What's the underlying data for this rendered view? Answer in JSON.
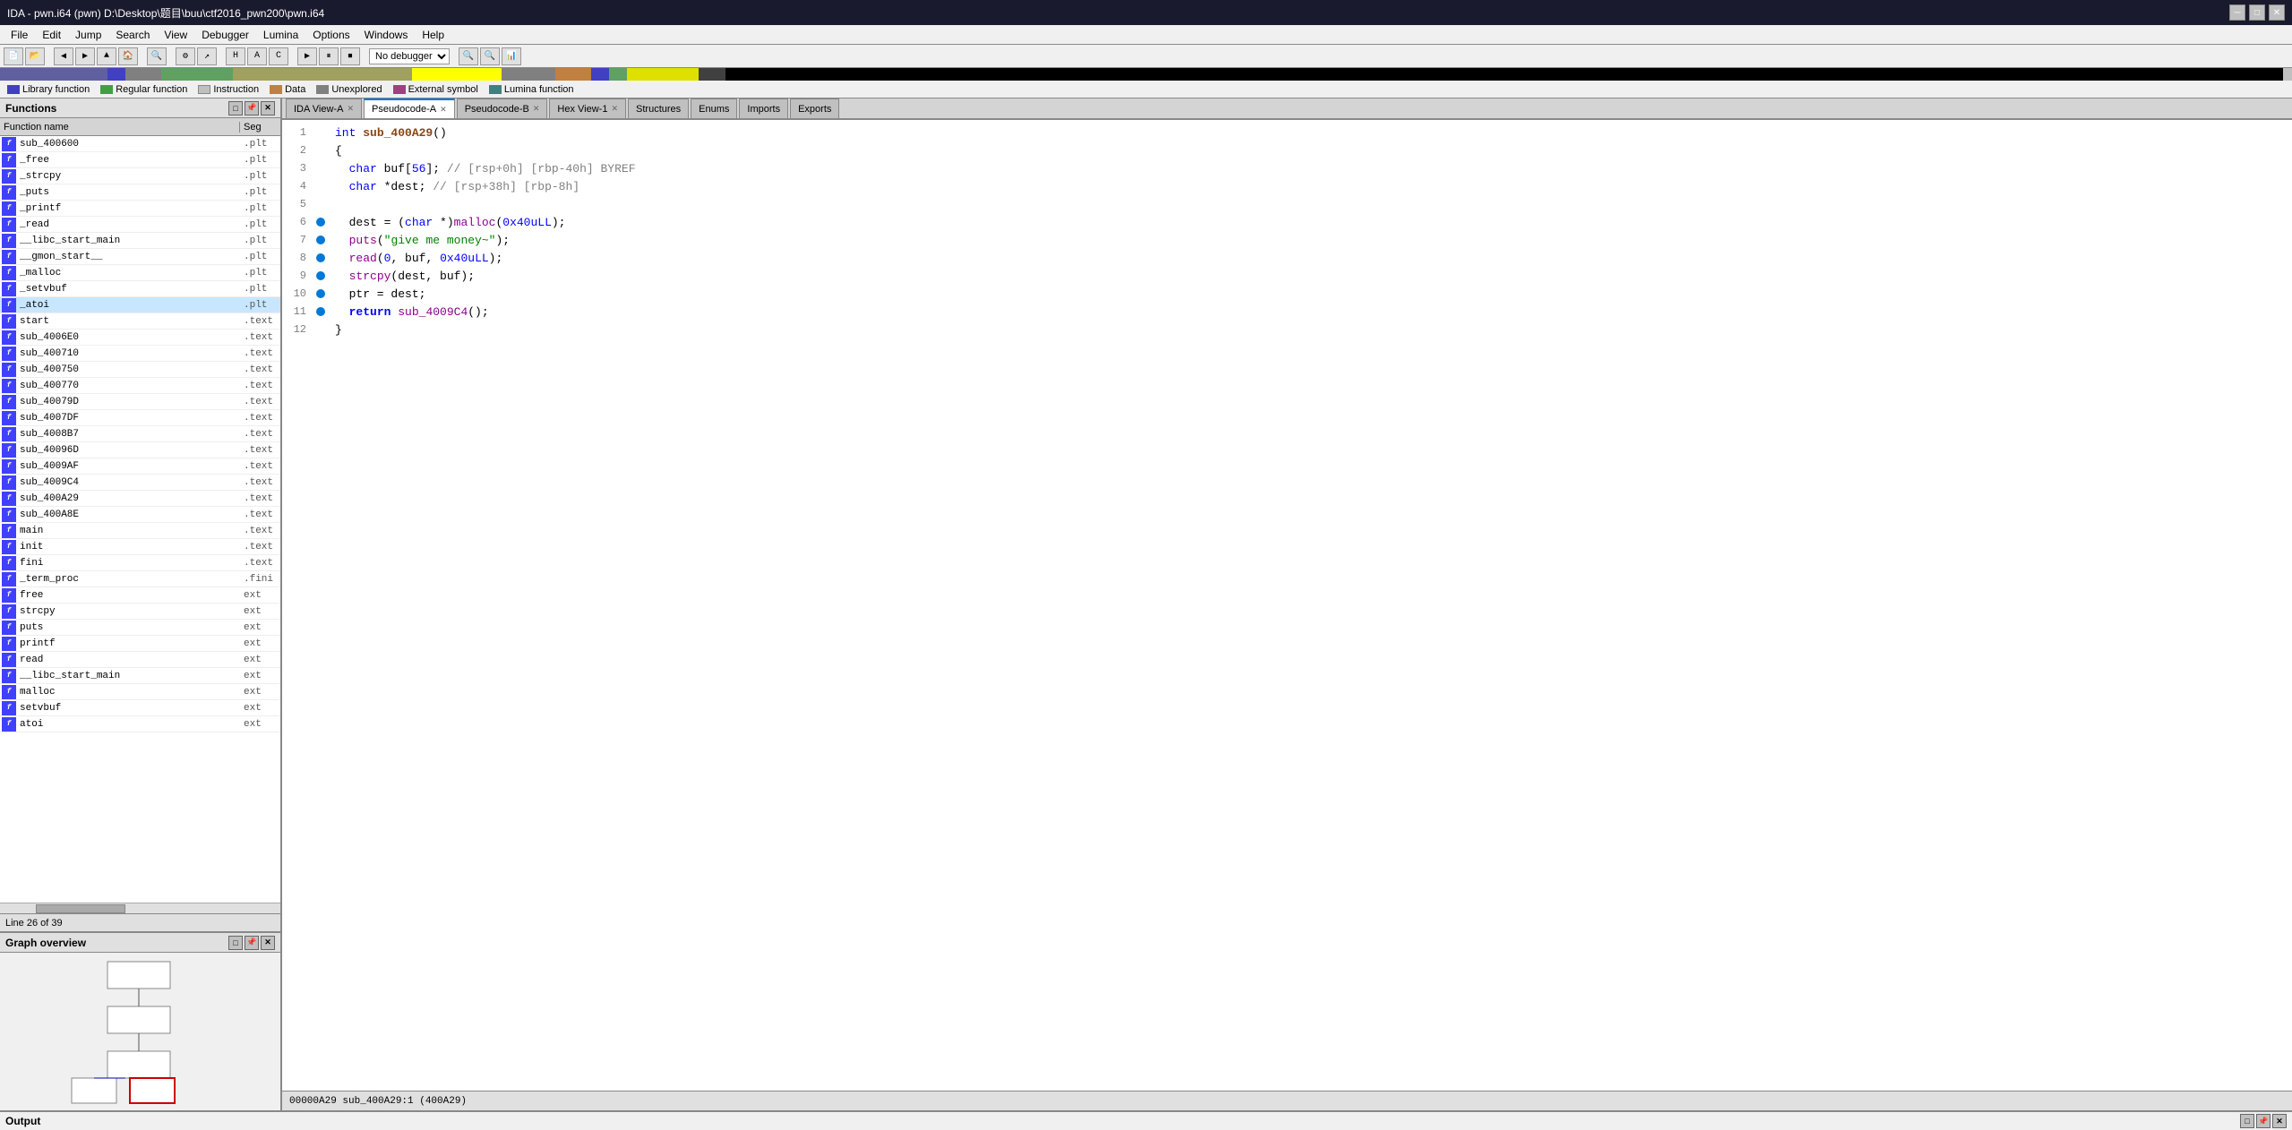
{
  "window": {
    "title": "IDA - pwn.i64 (pwn) D:\\Desktop\\题目\\buu\\ctf2016_pwn200\\pwn.i64",
    "controls": {
      "minimize": "─",
      "maximize": "□",
      "close": "✕"
    }
  },
  "menu": {
    "items": [
      "File",
      "Edit",
      "Jump",
      "Search",
      "View",
      "Debugger",
      "Lumina",
      "Options",
      "Windows",
      "Help"
    ]
  },
  "toolbar": {
    "debugger_select": "No debugger"
  },
  "legend": {
    "items": [
      {
        "label": "Library function",
        "color": "#4040c0"
      },
      {
        "label": "Regular function",
        "color": "#40a040"
      },
      {
        "label": "Instruction",
        "color": "#c0c0c0"
      },
      {
        "label": "Data",
        "color": "#c08040"
      },
      {
        "label": "Unexplored",
        "color": "#808080"
      },
      {
        "label": "External symbol",
        "color": "#a04080"
      },
      {
        "label": "Lumina function",
        "color": "#408080"
      }
    ]
  },
  "functions_panel": {
    "title": "Functions",
    "columns": {
      "name": "Function name",
      "seg": "Seg"
    },
    "items": [
      {
        "name": "sub_400600",
        "seg": ".plt",
        "icon": true,
        "type": "normal"
      },
      {
        "name": "_free",
        "seg": ".plt",
        "icon": true,
        "type": "normal"
      },
      {
        "name": "_strcpy",
        "seg": ".plt",
        "icon": true,
        "type": "normal"
      },
      {
        "name": "_puts",
        "seg": ".plt",
        "icon": true,
        "type": "normal"
      },
      {
        "name": "_printf",
        "seg": ".plt",
        "icon": true,
        "type": "normal"
      },
      {
        "name": "_read",
        "seg": ".plt",
        "icon": true,
        "type": "normal"
      },
      {
        "name": "__libc_start_main",
        "seg": ".plt",
        "icon": true,
        "type": "normal"
      },
      {
        "name": "__gmon_start__",
        "seg": ".plt",
        "icon": true,
        "type": "normal"
      },
      {
        "name": "_malloc",
        "seg": ".plt",
        "icon": true,
        "type": "normal"
      },
      {
        "name": "_setvbuf",
        "seg": ".plt",
        "icon": true,
        "type": "normal"
      },
      {
        "name": "_atoi",
        "seg": ".plt",
        "icon": true,
        "type": "selected"
      },
      {
        "name": "start",
        "seg": ".text",
        "icon": true,
        "type": "normal"
      },
      {
        "name": "sub_4006E0",
        "seg": ".text",
        "icon": true,
        "type": "normal"
      },
      {
        "name": "sub_400710",
        "seg": ".text",
        "icon": true,
        "type": "normal"
      },
      {
        "name": "sub_400750",
        "seg": ".text",
        "icon": true,
        "type": "normal"
      },
      {
        "name": "sub_400770",
        "seg": ".text",
        "icon": true,
        "type": "normal"
      },
      {
        "name": "sub_40079D",
        "seg": ".text",
        "icon": true,
        "type": "normal"
      },
      {
        "name": "sub_4007DF",
        "seg": ".text",
        "icon": true,
        "type": "normal"
      },
      {
        "name": "sub_4008B7",
        "seg": ".text",
        "icon": true,
        "type": "normal"
      },
      {
        "name": "sub_40096D",
        "seg": ".text",
        "icon": true,
        "type": "normal"
      },
      {
        "name": "sub_4009AF",
        "seg": ".text",
        "icon": true,
        "type": "normal"
      },
      {
        "name": "sub_4009C4",
        "seg": ".text",
        "icon": true,
        "type": "normal"
      },
      {
        "name": "sub_400A29",
        "seg": ".text",
        "icon": true,
        "type": "normal"
      },
      {
        "name": "sub_400A8E",
        "seg": ".text",
        "icon": true,
        "type": "normal"
      },
      {
        "name": "main",
        "seg": ".text",
        "icon": true,
        "type": "normal"
      },
      {
        "name": "init",
        "seg": ".text",
        "icon": true,
        "type": "normal"
      },
      {
        "name": "fini",
        "seg": ".text",
        "icon": true,
        "type": "normal"
      },
      {
        "name": "_term_proc",
        "seg": ".fini",
        "icon": true,
        "type": "normal"
      },
      {
        "name": "free",
        "seg": "ext",
        "icon": true,
        "type": "normal"
      },
      {
        "name": "strcpy",
        "seg": "ext",
        "icon": true,
        "type": "normal"
      },
      {
        "name": "puts",
        "seg": "ext",
        "icon": true,
        "type": "normal"
      },
      {
        "name": "printf",
        "seg": "ext",
        "icon": true,
        "type": "normal"
      },
      {
        "name": "read",
        "seg": "ext",
        "icon": true,
        "type": "normal"
      },
      {
        "name": "__libc_start_main",
        "seg": "ext",
        "icon": true,
        "type": "normal"
      },
      {
        "name": "malloc",
        "seg": "ext",
        "icon": true,
        "type": "normal"
      },
      {
        "name": "setvbuf",
        "seg": "ext",
        "icon": true,
        "type": "normal"
      },
      {
        "name": "atoi",
        "seg": "ext",
        "icon": true,
        "type": "normal"
      }
    ],
    "line_indicator": "Line 26 of 39"
  },
  "tabs": [
    {
      "label": "IDA View-A",
      "active": false,
      "closeable": true
    },
    {
      "label": "Pseudocode-A",
      "active": true,
      "closeable": true
    },
    {
      "label": "Pseudocode-B",
      "active": false,
      "closeable": true
    },
    {
      "label": "Hex View-1",
      "active": false,
      "closeable": true
    },
    {
      "label": "Structures",
      "active": false,
      "closeable": false
    },
    {
      "label": "Enums",
      "active": false,
      "closeable": false
    },
    {
      "label": "Imports",
      "active": false,
      "closeable": false
    },
    {
      "label": "Exports",
      "active": false,
      "closeable": false
    }
  ],
  "code": {
    "function_signature": "int sub_400A29()",
    "lines": [
      {
        "num": 1,
        "dot": false,
        "content": "int sub_400A29()"
      },
      {
        "num": 2,
        "dot": false,
        "content": "{"
      },
      {
        "num": 3,
        "dot": false,
        "content": "  char buf[56]; // [rsp+0h] [rbp-40h] BYREF"
      },
      {
        "num": 4,
        "dot": false,
        "content": "  char *dest; // [rsp+38h] [rbp-8h]"
      },
      {
        "num": 5,
        "dot": false,
        "content": ""
      },
      {
        "num": 6,
        "dot": true,
        "content": "  dest = (char *)malloc(0x40uLL);"
      },
      {
        "num": 7,
        "dot": true,
        "content": "  puts(\"give me money~\");"
      },
      {
        "num": 8,
        "dot": true,
        "content": "  read(0, buf, 0x40uLL);"
      },
      {
        "num": 9,
        "dot": true,
        "content": "  strcpy(dest, buf);"
      },
      {
        "num": 10,
        "dot": true,
        "content": "  ptr = dest;"
      },
      {
        "num": 11,
        "dot": true,
        "content": "  return sub_4009C4();"
      },
      {
        "num": 12,
        "dot": false,
        "content": "}"
      }
    ]
  },
  "graph_overview": {
    "title": "Graph overview"
  },
  "status_bar": {
    "text": "00000A29 sub_400A29:1 (400A29)"
  },
  "output_panel": {
    "title": "Output"
  }
}
